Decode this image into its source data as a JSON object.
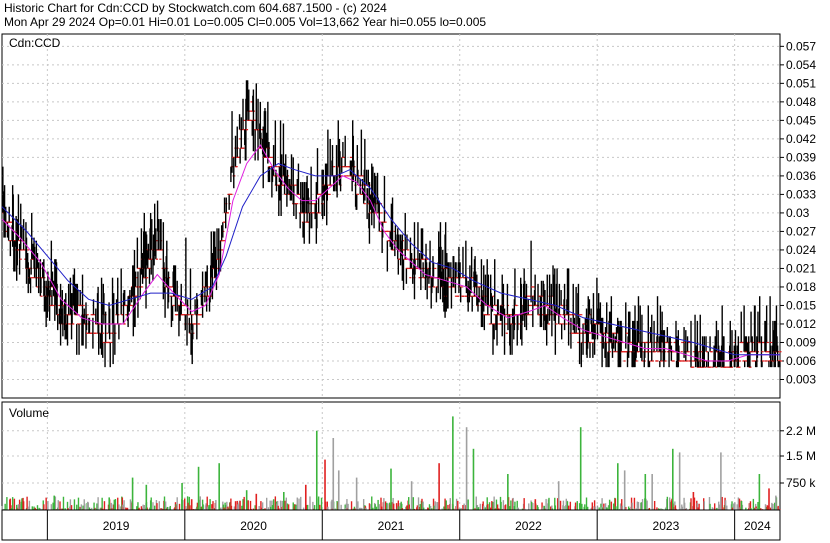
{
  "header": {
    "line1": "Historic Chart for Cdn:CCD by Stockwatch.com 604.687.1500 - (c) 2024",
    "line2": "Mon Apr 29 2024  Op=0.01  Hi=0.01  Lo=0.005  Cl=0.005  Vol=13,662  Year hi=0.055  lo=0.005"
  },
  "price_panel": {
    "label": "Cdn:CCD"
  },
  "volume_panel": {
    "label": "Volume"
  },
  "colors": {
    "up_volume": "#3cb43c",
    "down_volume": "#e02020",
    "flat_volume": "#a0a0a0",
    "ma_short": "#e020e0",
    "ma_long": "#2020c8",
    "bar": "#000000",
    "close_tick": "#e02020",
    "grid": "#c8c8c8"
  },
  "chart_data": [
    {
      "type": "line",
      "title": "Historic Chart for Cdn:CCD",
      "ylabel": "Cdn:CCD",
      "ylim": [
        0,
        0.059
      ],
      "y_ticks": [
        "0.057",
        "0.054",
        "0.051",
        "0.048",
        "0.045",
        "0.042",
        "0.039",
        "0.036",
        "0.033",
        "0.03",
        "0.027",
        "0.024",
        "0.021",
        "0.018",
        "0.015",
        "0.012",
        "0.009",
        "0.006",
        "0.003"
      ],
      "x_ticks": [
        "2019",
        "2020",
        "2021",
        "2022",
        "2023",
        "2024"
      ],
      "x_year_boundaries": [
        2019.0,
        2020.0,
        2021.0,
        2022.0,
        2023.0,
        2024.0
      ],
      "x_range": [
        2018.67,
        2024.33
      ],
      "price_path": [
        [
          2018.67,
          0.03
        ],
        [
          2018.72,
          0.027
        ],
        [
          2018.78,
          0.025
        ],
        [
          2018.85,
          0.022
        ],
        [
          2018.92,
          0.02
        ],
        [
          2018.98,
          0.018
        ],
        [
          2019.05,
          0.016
        ],
        [
          2019.1,
          0.014
        ],
        [
          2019.15,
          0.013
        ],
        [
          2019.22,
          0.014
        ],
        [
          2019.3,
          0.012
        ],
        [
          2019.38,
          0.011
        ],
        [
          2019.45,
          0.011
        ],
        [
          2019.52,
          0.013
        ],
        [
          2019.6,
          0.016
        ],
        [
          2019.68,
          0.02
        ],
        [
          2019.75,
          0.023
        ],
        [
          2019.8,
          0.025
        ],
        [
          2019.86,
          0.02
        ],
        [
          2019.92,
          0.016
        ],
        [
          2019.98,
          0.014
        ],
        [
          2020.05,
          0.012
        ],
        [
          2020.1,
          0.014
        ],
        [
          2020.18,
          0.018
        ],
        [
          2020.25,
          0.023
        ],
        [
          2020.3,
          0.03
        ],
        [
          2020.35,
          0.038
        ],
        [
          2020.42,
          0.043
        ],
        [
          2020.48,
          0.046
        ],
        [
          2020.55,
          0.042
        ],
        [
          2020.6,
          0.039
        ],
        [
          2020.68,
          0.036
        ],
        [
          2020.75,
          0.034
        ],
        [
          2020.82,
          0.032
        ],
        [
          2020.88,
          0.03
        ],
        [
          2020.95,
          0.031
        ],
        [
          2021.02,
          0.034
        ],
        [
          2021.1,
          0.037
        ],
        [
          2021.18,
          0.037
        ],
        [
          2021.25,
          0.035
        ],
        [
          2021.32,
          0.033
        ],
        [
          2021.4,
          0.03
        ],
        [
          2021.48,
          0.027
        ],
        [
          2021.55,
          0.024
        ],
        [
          2021.62,
          0.022
        ],
        [
          2021.7,
          0.021
        ],
        [
          2021.78,
          0.02
        ],
        [
          2021.85,
          0.019
        ],
        [
          2021.92,
          0.019
        ],
        [
          2022.0,
          0.018
        ],
        [
          2022.08,
          0.018
        ],
        [
          2022.15,
          0.016
        ],
        [
          2022.22,
          0.014
        ],
        [
          2022.3,
          0.013
        ],
        [
          2022.38,
          0.013
        ],
        [
          2022.45,
          0.014
        ],
        [
          2022.52,
          0.016
        ],
        [
          2022.6,
          0.015
        ],
        [
          2022.68,
          0.014
        ],
        [
          2022.75,
          0.013
        ],
        [
          2022.82,
          0.012
        ],
        [
          2022.9,
          0.011
        ],
        [
          2022.98,
          0.011
        ],
        [
          2023.05,
          0.01
        ],
        [
          2023.12,
          0.009
        ],
        [
          2023.2,
          0.008
        ],
        [
          2023.28,
          0.008
        ],
        [
          2023.35,
          0.008
        ],
        [
          2023.42,
          0.008
        ],
        [
          2023.5,
          0.008
        ],
        [
          2023.58,
          0.007
        ],
        [
          2023.65,
          0.007
        ],
        [
          2023.72,
          0.006
        ],
        [
          2023.8,
          0.006
        ],
        [
          2023.88,
          0.006
        ],
        [
          2023.95,
          0.006
        ],
        [
          2024.02,
          0.007
        ],
        [
          2024.1,
          0.007
        ],
        [
          2024.18,
          0.008
        ],
        [
          2024.25,
          0.007
        ],
        [
          2024.33,
          0.006
        ]
      ],
      "series": [
        {
          "values_kind": "ma_short",
          "points": [
            [
              2018.67,
              0.029
            ],
            [
              2018.8,
              0.026
            ],
            [
              2018.95,
              0.022
            ],
            [
              2019.1,
              0.016
            ],
            [
              2019.25,
              0.013
            ],
            [
              2019.4,
              0.012
            ],
            [
              2019.55,
              0.012
            ],
            [
              2019.7,
              0.017
            ],
            [
              2019.8,
              0.02
            ],
            [
              2019.92,
              0.017
            ],
            [
              2020.05,
              0.014
            ],
            [
              2020.15,
              0.015
            ],
            [
              2020.25,
              0.02
            ],
            [
              2020.35,
              0.032
            ],
            [
              2020.45,
              0.038
            ],
            [
              2020.55,
              0.041
            ],
            [
              2020.65,
              0.037
            ],
            [
              2020.75,
              0.034
            ],
            [
              2020.85,
              0.032
            ],
            [
              2020.95,
              0.032
            ],
            [
              2021.05,
              0.034
            ],
            [
              2021.15,
              0.036
            ],
            [
              2021.25,
              0.035
            ],
            [
              2021.35,
              0.032
            ],
            [
              2021.45,
              0.027
            ],
            [
              2021.55,
              0.024
            ],
            [
              2021.65,
              0.022
            ],
            [
              2021.75,
              0.02
            ],
            [
              2021.9,
              0.019
            ],
            [
              2022.05,
              0.018
            ],
            [
              2022.2,
              0.015
            ],
            [
              2022.35,
              0.013
            ],
            [
              2022.5,
              0.014
            ],
            [
              2022.62,
              0.015
            ],
            [
              2022.75,
              0.013
            ],
            [
              2022.9,
              0.011
            ],
            [
              2023.05,
              0.01
            ],
            [
              2023.2,
              0.009
            ],
            [
              2023.35,
              0.008
            ],
            [
              2023.5,
              0.008
            ],
            [
              2023.65,
              0.007
            ],
            [
              2023.8,
              0.006
            ],
            [
              2023.95,
              0.006
            ],
            [
              2024.1,
              0.007
            ],
            [
              2024.2,
              0.007
            ],
            [
              2024.33,
              0.007
            ]
          ]
        },
        {
          "values_kind": "ma_long",
          "points": [
            [
              2018.67,
              0.031
            ],
            [
              2018.85,
              0.027
            ],
            [
              2019.0,
              0.023
            ],
            [
              2019.15,
              0.019
            ],
            [
              2019.3,
              0.016
            ],
            [
              2019.45,
              0.015
            ],
            [
              2019.6,
              0.016
            ],
            [
              2019.75,
              0.017
            ],
            [
              2019.9,
              0.017
            ],
            [
              2020.05,
              0.016
            ],
            [
              2020.2,
              0.018
            ],
            [
              2020.3,
              0.023
            ],
            [
              2020.42,
              0.031
            ],
            [
              2020.55,
              0.036
            ],
            [
              2020.68,
              0.038
            ],
            [
              2020.8,
              0.037
            ],
            [
              2020.95,
              0.036
            ],
            [
              2021.1,
              0.036
            ],
            [
              2021.2,
              0.037
            ],
            [
              2021.35,
              0.034
            ],
            [
              2021.5,
              0.029
            ],
            [
              2021.65,
              0.025
            ],
            [
              2021.8,
              0.022
            ],
            [
              2021.95,
              0.021
            ],
            [
              2022.1,
              0.019
            ],
            [
              2022.3,
              0.017
            ],
            [
              2022.5,
              0.016
            ],
            [
              2022.7,
              0.015
            ],
            [
              2022.9,
              0.013
            ],
            [
              2023.1,
              0.012
            ],
            [
              2023.3,
              0.011
            ],
            [
              2023.5,
              0.01
            ],
            [
              2023.7,
              0.009
            ],
            [
              2023.85,
              0.008
            ],
            [
              2024.0,
              0.007
            ],
            [
              2024.15,
              0.007
            ],
            [
              2024.33,
              0.007
            ]
          ]
        }
      ]
    },
    {
      "type": "bar",
      "title": "Volume",
      "y_ticks": [
        "2.2 M",
        "1.5 M",
        "750 k"
      ],
      "y_tick_values": [
        2200000,
        1500000,
        750000
      ],
      "ylim": [
        0,
        3000000
      ],
      "spikes": [
        [
          2019.05,
          400000,
          "up"
        ],
        [
          2019.45,
          350000,
          "up"
        ],
        [
          2019.62,
          900000,
          "up"
        ],
        [
          2019.72,
          700000,
          "up"
        ],
        [
          2019.98,
          750000,
          "up"
        ],
        [
          2020.05,
          300000,
          "down"
        ],
        [
          2020.1,
          1200000,
          "up"
        ],
        [
          2020.25,
          1300000,
          "up"
        ],
        [
          2020.45,
          550000,
          "up"
        ],
        [
          2020.52,
          450000,
          "down"
        ],
        [
          2020.72,
          500000,
          "up"
        ],
        [
          2020.88,
          700000,
          "down"
        ],
        [
          2020.96,
          2200000,
          "up"
        ],
        [
          2021.02,
          1400000,
          "down"
        ],
        [
          2021.08,
          2000000,
          "flat"
        ],
        [
          2021.12,
          1100000,
          "flat"
        ],
        [
          2021.25,
          900000,
          "flat"
        ],
        [
          2021.5,
          1150000,
          "up"
        ],
        [
          2021.65,
          800000,
          "flat"
        ],
        [
          2021.85,
          1300000,
          "down"
        ],
        [
          2021.95,
          2600000,
          "up"
        ],
        [
          2022.05,
          2300000,
          "flat"
        ],
        [
          2022.1,
          1700000,
          "up"
        ],
        [
          2022.35,
          1000000,
          "up"
        ],
        [
          2022.55,
          300000,
          "down"
        ],
        [
          2022.72,
          800000,
          "flat"
        ],
        [
          2022.88,
          2300000,
          "up"
        ],
        [
          2023.15,
          1300000,
          "up"
        ],
        [
          2023.2,
          1100000,
          "flat"
        ],
        [
          2023.35,
          1000000,
          "up"
        ],
        [
          2023.4,
          1000000,
          "flat"
        ],
        [
          2023.55,
          1700000,
          "up"
        ],
        [
          2023.6,
          1600000,
          "flat"
        ],
        [
          2023.7,
          500000,
          "down"
        ],
        [
          2023.9,
          1600000,
          "flat"
        ],
        [
          2024.05,
          250000,
          "up"
        ],
        [
          2024.18,
          1000000,
          "up"
        ],
        [
          2024.25,
          600000,
          "down"
        ],
        [
          2024.3,
          400000,
          "flat"
        ]
      ]
    }
  ]
}
